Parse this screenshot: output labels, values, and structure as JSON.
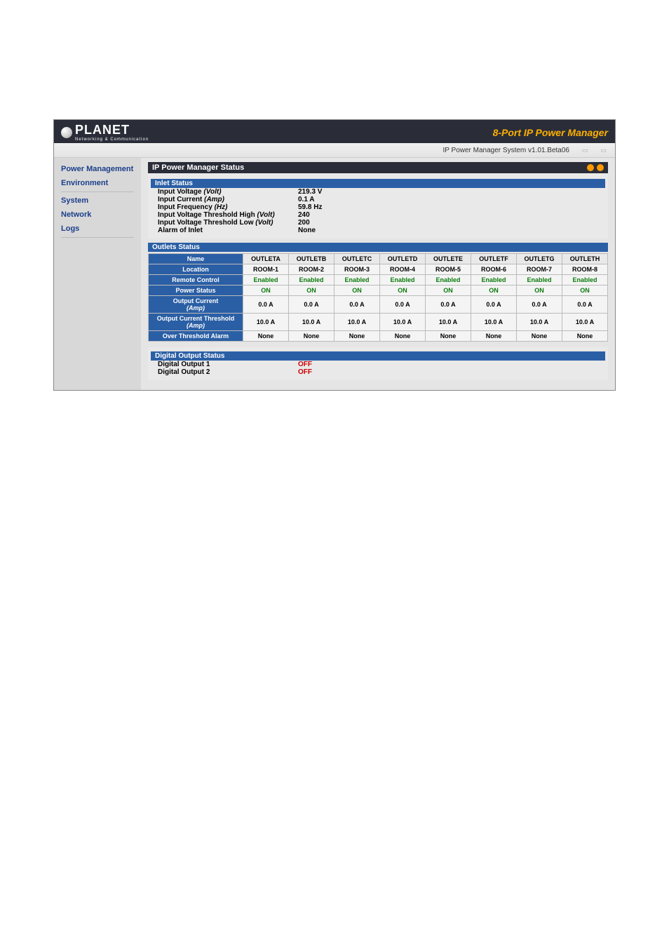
{
  "header": {
    "logo_text": "PLANET",
    "logo_sub": "Networking & Communication",
    "product_title": "8-Port IP Power Manager",
    "system_version": "IP Power Manager System v1.01.Beta06"
  },
  "sidebar": {
    "items": [
      {
        "label": "Power Management"
      },
      {
        "label": "Environment"
      },
      {
        "label": "System"
      },
      {
        "label": "Network"
      },
      {
        "label": "Logs"
      }
    ]
  },
  "main": {
    "status_title": "IP Power Manager Status",
    "inlet_header": "Inlet Status",
    "inlet": [
      {
        "label": "Input Voltage",
        "unit": "(Volt)",
        "value": "219.3 V"
      },
      {
        "label": "Input Current",
        "unit": "(Amp)",
        "value": "0.1 A"
      },
      {
        "label": "Input Frequency",
        "unit": "(Hz)",
        "value": "59.8 Hz"
      },
      {
        "label": "Input Voltage Threshold High",
        "unit": "(Volt)",
        "value": "240"
      },
      {
        "label": "Input Voltage Threshold Low",
        "unit": "(Volt)",
        "value": "200"
      },
      {
        "label": "Alarm of Inlet",
        "unit": "",
        "value": "None"
      }
    ],
    "outlets_header": "Outlets Status",
    "outlet_columns": [
      "OUTLETA",
      "OUTLETB",
      "OUTLETC",
      "OUTLETD",
      "OUTLETE",
      "OUTLETF",
      "OUTLETG",
      "OUTLETH"
    ],
    "outlet_rows": {
      "name_label": "Name",
      "location_label": "Location",
      "remote_label": "Remote Control",
      "power_label": "Power Status",
      "output_current_label": "Output Current",
      "output_current_unit": "(Amp)",
      "threshold_label": "Output Current Threshold",
      "threshold_unit": "(Amp)",
      "alarm_label": "Over Threshold Alarm",
      "location": [
        "ROOM-1",
        "ROOM-2",
        "ROOM-3",
        "ROOM-4",
        "ROOM-5",
        "ROOM-6",
        "ROOM-7",
        "ROOM-8"
      ],
      "remote": [
        "Enabled",
        "Enabled",
        "Enabled",
        "Enabled",
        "Enabled",
        "Enabled",
        "Enabled",
        "Enabled"
      ],
      "power": [
        "ON",
        "ON",
        "ON",
        "ON",
        "ON",
        "ON",
        "ON",
        "ON"
      ],
      "output_current": [
        "0.0 A",
        "0.0 A",
        "0.0 A",
        "0.0 A",
        "0.0 A",
        "0.0 A",
        "0.0 A",
        "0.0 A"
      ],
      "threshold": [
        "10.0 A",
        "10.0 A",
        "10.0 A",
        "10.0 A",
        "10.0 A",
        "10.0 A",
        "10.0 A",
        "10.0 A"
      ],
      "alarm": [
        "None",
        "None",
        "None",
        "None",
        "None",
        "None",
        "None",
        "None"
      ]
    },
    "digital_header": "Digital Output Status",
    "digital": [
      {
        "label": "Digital Output 1",
        "value": "OFF"
      },
      {
        "label": "Digital Output 2",
        "value": "OFF"
      }
    ]
  }
}
